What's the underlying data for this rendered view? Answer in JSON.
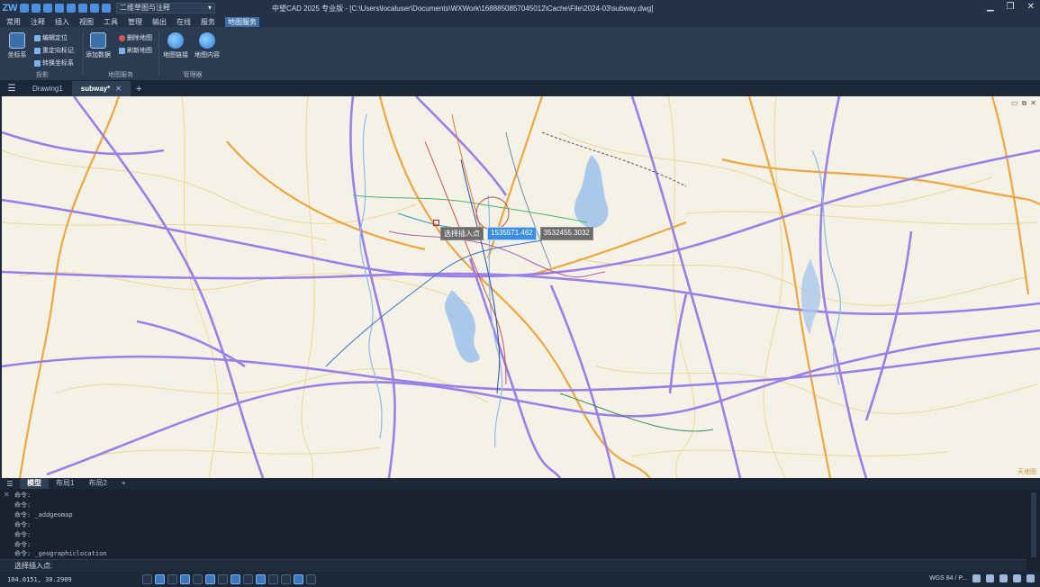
{
  "window": {
    "title": "中望CAD 2025 专业版 - [C:\\Users\\localuser\\Documents\\WXWork\\1688850857045012\\Cache\\File\\2024-03\\subway.dwg]",
    "workspace": "二维草图与注释",
    "controls": [
      "▁",
      "❐",
      "✕"
    ]
  },
  "menu": {
    "items": [
      "常用",
      "注释",
      "插入",
      "视图",
      "工具",
      "管理",
      "输出",
      "在线",
      "服务",
      "地图服务"
    ]
  },
  "ribbon": {
    "coord_btn": "坐标系",
    "edit_loc": "编辑定位",
    "reset_nav": "重定向标记",
    "convert_coord": "转换坐标系",
    "group_proj": "投影",
    "add_data": "添加数据",
    "delete_map": "删除地图",
    "refresh_map": "刷新地图",
    "group_map": "地图服务",
    "map_link": "地图链接",
    "map_content": "地图内容",
    "group_manager": "管理器"
  },
  "tabs": {
    "drawing1": "Drawing1",
    "subway": "subway*",
    "close": "✕",
    "plus": "+"
  },
  "viewport": {
    "prompt_label": "选择插入点",
    "x_value": "1535571.462",
    "y_value": "3532455.3032",
    "controls": [
      "▭",
      "⧉",
      "✕"
    ],
    "watermark": "天地图"
  },
  "layout_tabs": {
    "model": "模型",
    "layout1": "布局1",
    "layout2": "布局2",
    "plus": "+"
  },
  "command": {
    "history": [
      "命令:",
      "命令:",
      "命令:  _addgeomap",
      "命令:",
      "命令:",
      "命令:",
      "命令:  _geographiclocation"
    ],
    "prompt": "选择插入点:",
    "left_label": "✕"
  },
  "status": {
    "coords": "104.0151, 30.2909",
    "right_label": "WGS 84 / P..."
  }
}
